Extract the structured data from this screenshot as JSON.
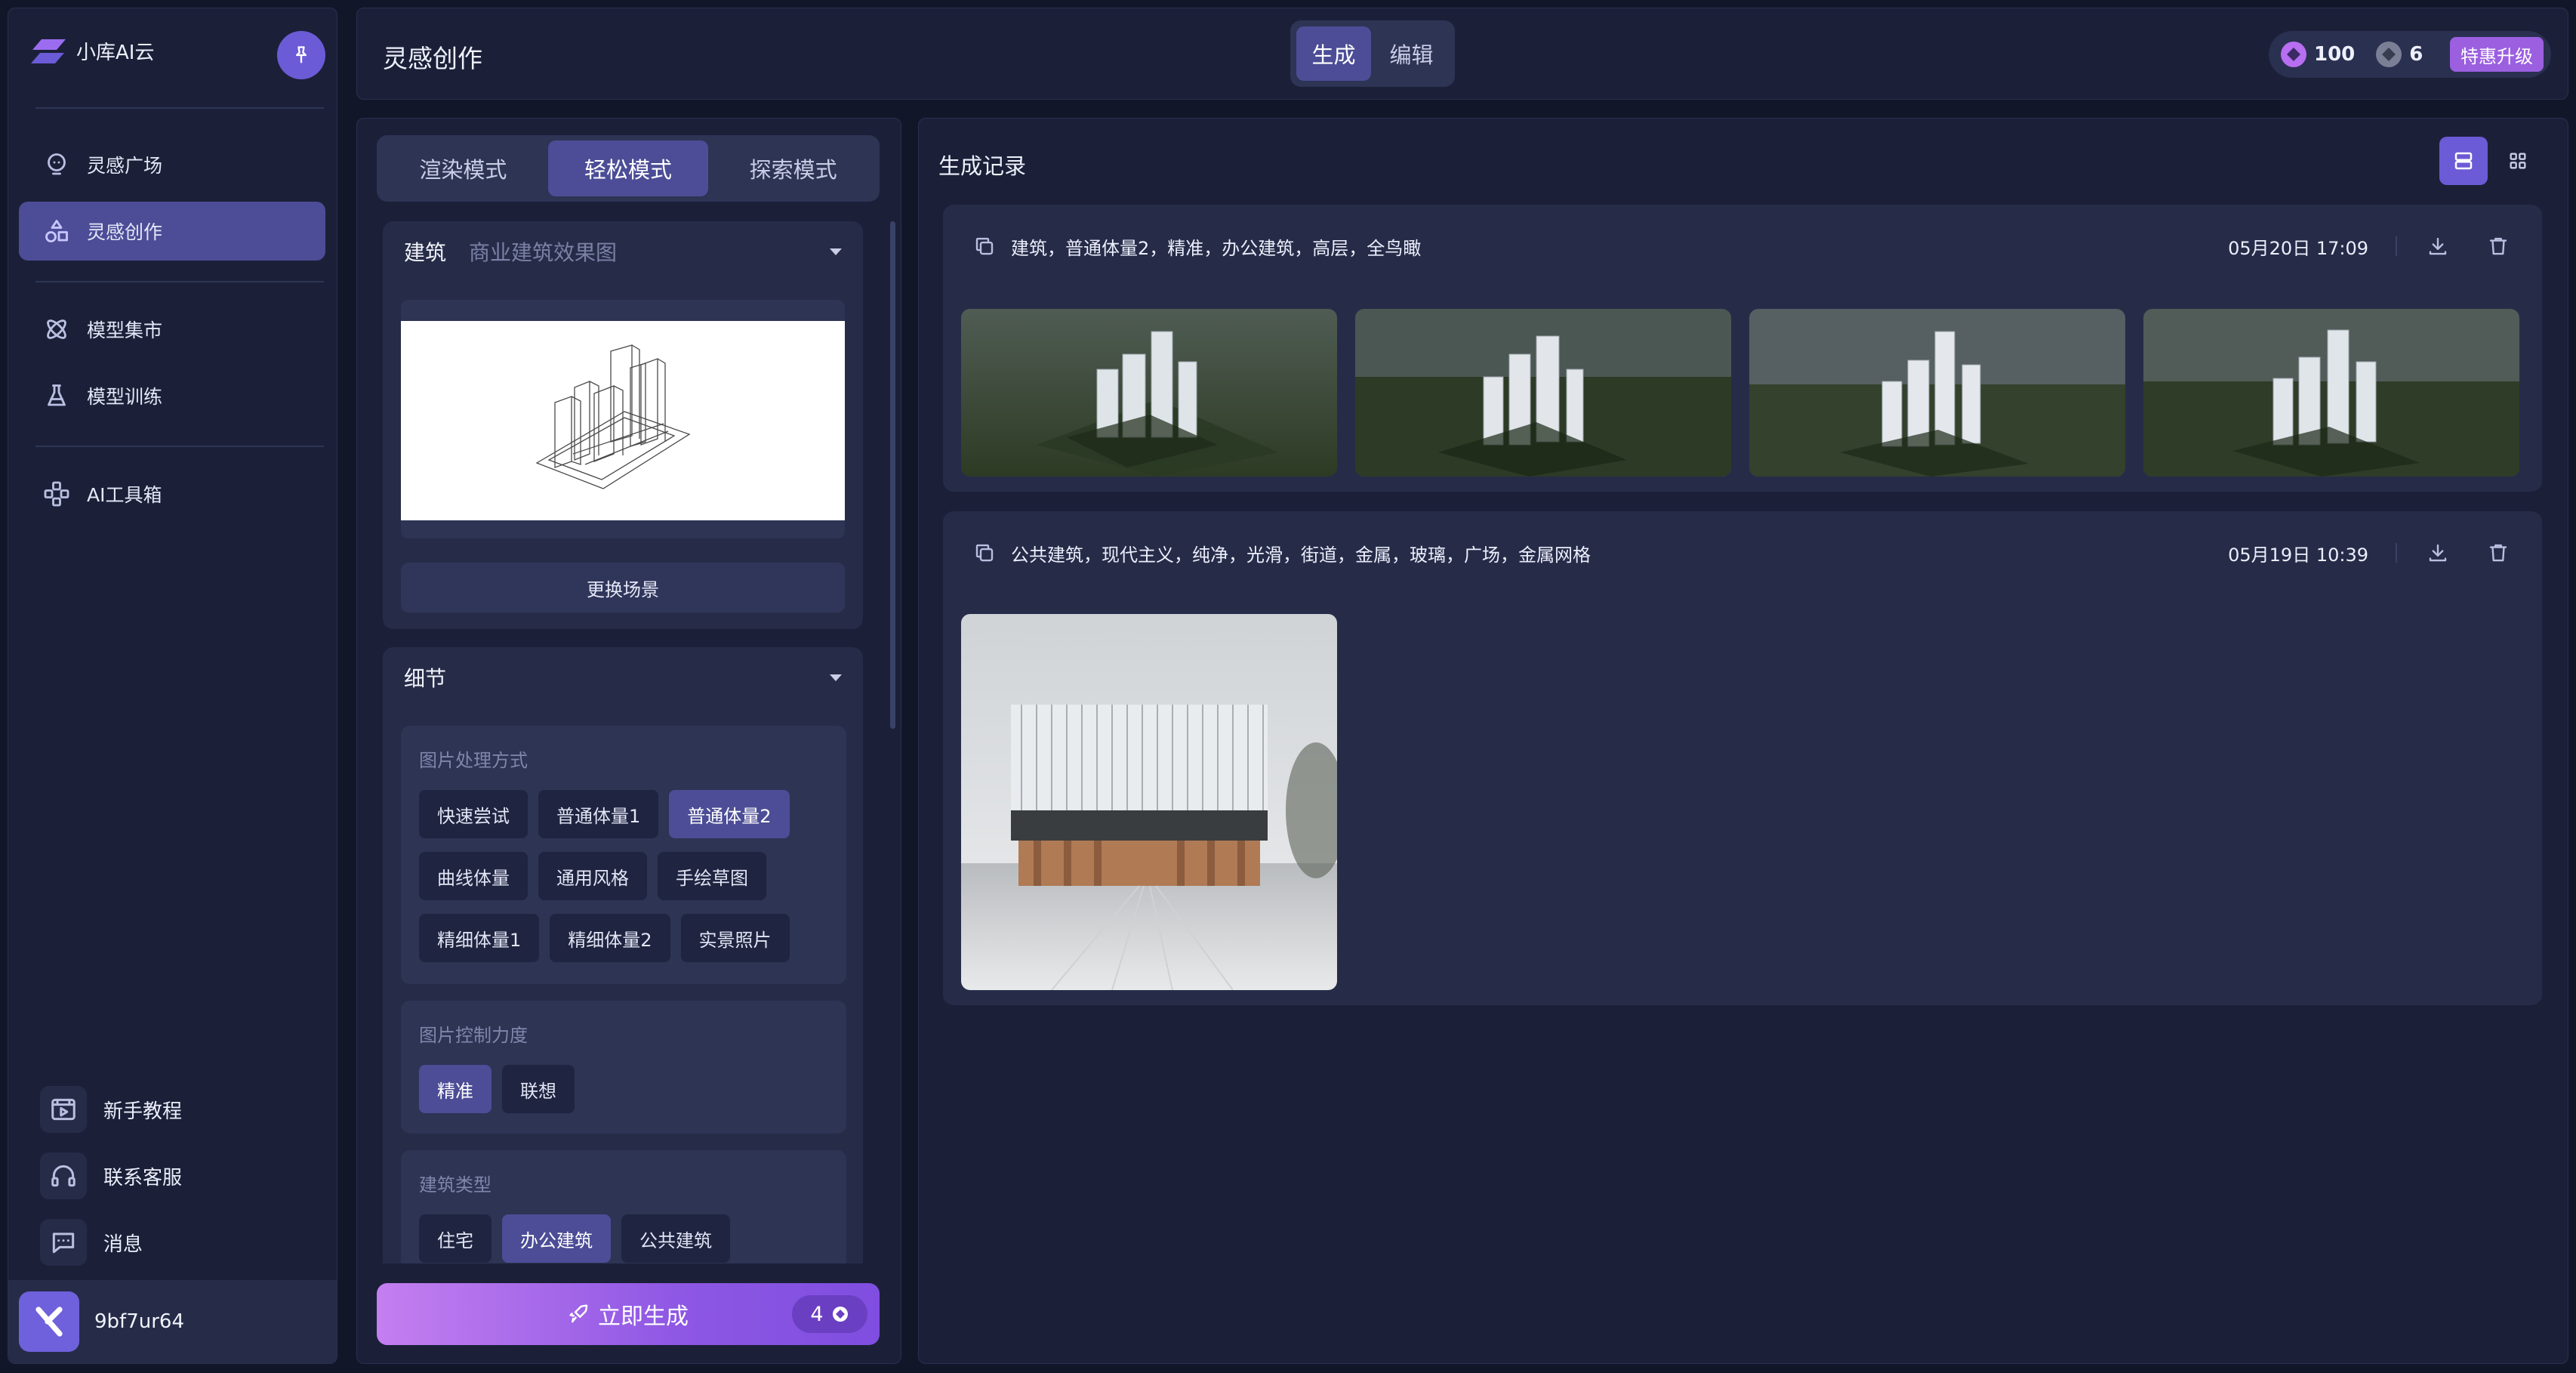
{
  "sidebar": {
    "brand": "小库AI云",
    "nav": [
      {
        "label": "灵感广场",
        "icon": "lightbulb-icon"
      },
      {
        "label": "灵感创作",
        "icon": "shapes-icon",
        "active": true
      },
      {
        "label": "模型集市",
        "icon": "atom-icon"
      },
      {
        "label": "模型训练",
        "icon": "flask-icon"
      },
      {
        "label": "AI工具箱",
        "icon": "toolbox-icon"
      }
    ],
    "bottom": [
      {
        "label": "新手教程",
        "icon": "video-icon"
      },
      {
        "label": "联系客服",
        "icon": "headset-icon"
      },
      {
        "label": "消息",
        "icon": "message-icon"
      }
    ],
    "user": {
      "name": "9bf7ur64"
    }
  },
  "header": {
    "title": "灵感创作",
    "tabs": [
      "生成",
      "编辑"
    ],
    "active_tab": "生成",
    "credits": [
      {
        "value": "100",
        "color": "#b76ef0"
      },
      {
        "value": "6",
        "color": "#7b7f96"
      }
    ],
    "upgrade": "特惠升级"
  },
  "left": {
    "modes": [
      "渲染模式",
      "轻松模式",
      "探索模式"
    ],
    "active_mode": "轻松模式",
    "scene": {
      "category": "建筑",
      "placeholder": "商业建筑效果图",
      "change_label": "更换场景"
    },
    "detail": {
      "title": "细节",
      "groups": [
        {
          "title": "图片处理方式",
          "options": [
            "快速尝试",
            "普通体量1",
            "普通体量2",
            "曲线体量",
            "通用风格",
            "手绘草图",
            "精细体量1",
            "精细体量2",
            "实景照片"
          ],
          "active": "普通体量2"
        },
        {
          "title": "图片控制力度",
          "options": [
            "精准",
            "联想"
          ],
          "active": "精准"
        },
        {
          "title": "建筑类型",
          "options": [
            "住宅",
            "办公建筑",
            "公共建筑"
          ],
          "active": "办公建筑"
        }
      ]
    },
    "generate": {
      "label": "立即生成",
      "count": "4"
    }
  },
  "records": {
    "title": "生成记录",
    "items": [
      {
        "prompt": "建筑，普通体量2，精准，办公建筑，高层，全鸟瞰",
        "date": "05月20日 17:09",
        "images": 4
      },
      {
        "prompt": "公共建筑，现代主义，纯净，光滑，街道，金属，玻璃，广场，金属网格",
        "date": "05月19日 10:39",
        "images": 1
      }
    ]
  },
  "colors": {
    "accent": "#6b5bd6",
    "active": "#4c4d96",
    "panel": "#1b2038",
    "card": "#262c48"
  }
}
